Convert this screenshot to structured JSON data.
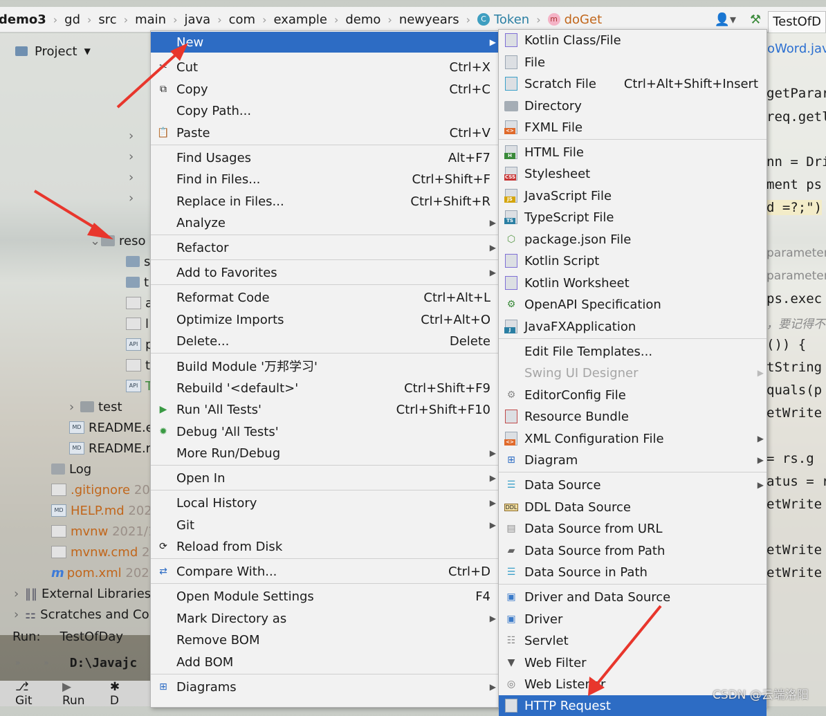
{
  "breadcrumb": [
    "demo3",
    "gd",
    "src",
    "main",
    "java",
    "com",
    "example",
    "demo",
    "newyears",
    "Token",
    "doGet"
  ],
  "toolbar": {
    "tab_label": "TestOfD"
  },
  "project": {
    "header": "Project",
    "rows": [
      {
        "label": "reso"
      },
      {
        "label": "s"
      },
      {
        "label": "t"
      },
      {
        "label": "a"
      },
      {
        "label": "l"
      },
      {
        "label": "p"
      },
      {
        "label": "t"
      },
      {
        "label": "T"
      },
      {
        "label": "test"
      },
      {
        "label": "README.e"
      },
      {
        "label": "README.r"
      },
      {
        "label": "Log"
      },
      {
        "label": ".gitignore",
        "meta": "20"
      },
      {
        "label": "HELP.md",
        "meta": "202"
      },
      {
        "label": "mvnw",
        "meta": "2021/1"
      },
      {
        "label": "mvnw.cmd",
        "meta": "2("
      },
      {
        "label": "pom.xml",
        "meta": "202"
      },
      {
        "label": "External Libraries"
      },
      {
        "label": "Scratches and Co"
      }
    ]
  },
  "run": {
    "label": "Run:",
    "config": "TestOfDay",
    "console": "D:\\Javajc"
  },
  "bottom_bar": {
    "git": "Git",
    "run": "Run",
    "d": "D"
  },
  "editor": {
    "lines": [
      "loWord.jav",
      "getParar",
      "req.getl",
      "nn = Dri",
      "ment ps",
      "d =?;\")",
      "parameter",
      "parameter",
      " ps.exec",
      "，要记得不",
      "()) {",
      "tString",
      "quals(p",
      "etWrite",
      " = rs.g",
      "atus = r",
      "etWrite",
      "etWrite",
      "etWrite"
    ]
  },
  "context_menu": {
    "items": [
      {
        "label": "New",
        "shortcut": "",
        "submenu": true,
        "icon": ""
      },
      {
        "label": "Cut",
        "shortcut": "Ctrl+X",
        "icon": "scissors-icon"
      },
      {
        "label": "Copy",
        "shortcut": "Ctrl+C",
        "icon": "copy-icon"
      },
      {
        "label": "Copy Path...",
        "shortcut": ""
      },
      {
        "label": "Paste",
        "shortcut": "Ctrl+V",
        "icon": "paste-icon"
      },
      {
        "label": "Find Usages",
        "shortcut": "Alt+F7"
      },
      {
        "label": "Find in Files...",
        "shortcut": "Ctrl+Shift+F"
      },
      {
        "label": "Replace in Files...",
        "shortcut": "Ctrl+Shift+R"
      },
      {
        "label": "Analyze",
        "submenu": true
      },
      {
        "label": "Refactor",
        "submenu": true
      },
      {
        "label": "Add to Favorites",
        "submenu": true
      },
      {
        "label": "Reformat Code",
        "shortcut": "Ctrl+Alt+L"
      },
      {
        "label": "Optimize Imports",
        "shortcut": "Ctrl+Alt+O"
      },
      {
        "label": "Delete...",
        "shortcut": "Delete"
      },
      {
        "label": "Build Module '万邦学习'",
        "shortcut": ""
      },
      {
        "label": "Rebuild '<default>'",
        "shortcut": "Ctrl+Shift+F9"
      },
      {
        "label": "Run 'All Tests'",
        "shortcut": "Ctrl+Shift+F10",
        "icon": "run-icon"
      },
      {
        "label": "Debug 'All Tests'",
        "shortcut": "",
        "icon": "debug-icon"
      },
      {
        "label": "More Run/Debug",
        "submenu": true
      },
      {
        "label": "Open In",
        "submenu": true
      },
      {
        "label": "Local History",
        "submenu": true
      },
      {
        "label": "Git",
        "submenu": true
      },
      {
        "label": "Reload from Disk",
        "icon": "reload-icon"
      },
      {
        "label": "Compare With...",
        "shortcut": "Ctrl+D",
        "icon": "compare-icon"
      },
      {
        "label": "Open Module Settings",
        "shortcut": "F4"
      },
      {
        "label": "Mark Directory as",
        "submenu": true
      },
      {
        "label": "Remove BOM"
      },
      {
        "label": "Add BOM"
      },
      {
        "label": "Diagrams",
        "submenu": true,
        "icon": "diagram-icon"
      }
    ]
  },
  "new_submenu": {
    "items": [
      {
        "label": "Kotlin Class/File"
      },
      {
        "label": "File"
      },
      {
        "label": "Scratch File",
        "shortcut": "Ctrl+Alt+Shift+Insert"
      },
      {
        "label": "Directory"
      },
      {
        "label": "FXML File"
      },
      {
        "label": "HTML File",
        "tag": "H"
      },
      {
        "label": "Stylesheet",
        "tag": "CSS"
      },
      {
        "label": "JavaScript File",
        "tag": "JS"
      },
      {
        "label": "TypeScript File",
        "tag": "TS"
      },
      {
        "label": "package.json File"
      },
      {
        "label": "Kotlin Script"
      },
      {
        "label": "Kotlin Worksheet"
      },
      {
        "label": "OpenAPI Specification"
      },
      {
        "label": "JavaFXApplication",
        "tag": "J"
      },
      {
        "label": "Edit File Templates..."
      },
      {
        "label": "Swing UI Designer",
        "disabled": true,
        "submenu": true
      },
      {
        "label": "EditorConfig File"
      },
      {
        "label": "Resource Bundle"
      },
      {
        "label": "XML Configuration File",
        "submenu": true
      },
      {
        "label": "Diagram",
        "submenu": true
      },
      {
        "label": "Data Source",
        "submenu": true
      },
      {
        "label": "DDL Data Source",
        "tag": "DDL"
      },
      {
        "label": "Data Source from URL"
      },
      {
        "label": "Data Source from Path"
      },
      {
        "label": "Data Source in Path"
      },
      {
        "label": "Driver and Data Source"
      },
      {
        "label": "Driver"
      },
      {
        "label": "Servlet"
      },
      {
        "label": "Web Filter"
      },
      {
        "label": "Web Listener"
      },
      {
        "label": "HTTP Request"
      }
    ]
  },
  "watermark": "CSDN @云端洛阳",
  "colors": {
    "selection": "#2d6cc4",
    "arrow": "#e8362c",
    "menu_bg": "#f2f2f2"
  }
}
